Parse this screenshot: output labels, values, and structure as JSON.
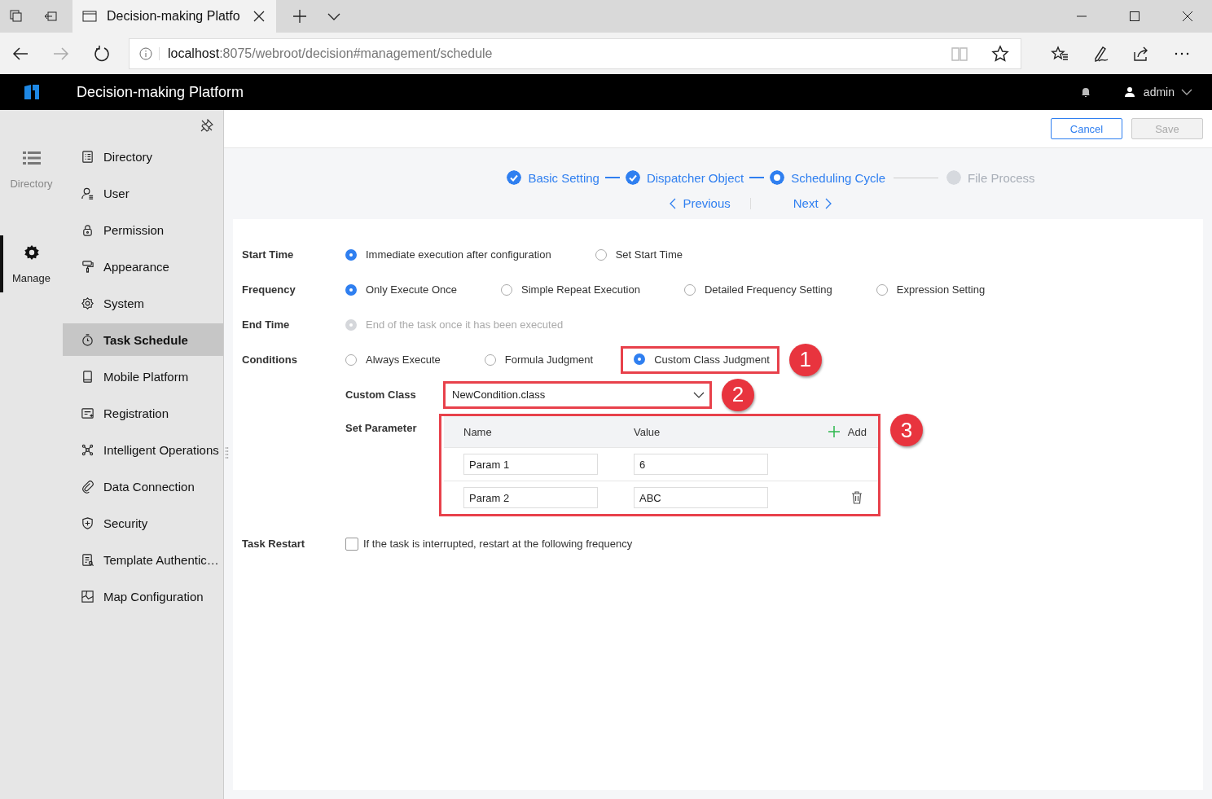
{
  "browser": {
    "tabs": [
      {
        "title": "Decision-making Platfo",
        "selected": true
      }
    ],
    "address": {
      "host": "localhost",
      "path": ":8075/webroot/decision#management/schedule"
    }
  },
  "app": {
    "title": "Decision-making Platform",
    "user": "admin"
  },
  "rail": [
    {
      "label": "Directory",
      "selected": false
    },
    {
      "label": "Manage",
      "selected": true
    }
  ],
  "menu": [
    {
      "label": "Directory",
      "selected": false
    },
    {
      "label": "User",
      "selected": false
    },
    {
      "label": "Permission",
      "selected": false
    },
    {
      "label": "Appearance",
      "selected": false
    },
    {
      "label": "System",
      "selected": false
    },
    {
      "label": "Task Schedule",
      "selected": true
    },
    {
      "label": "Mobile Platform",
      "selected": false
    },
    {
      "label": "Registration",
      "selected": false
    },
    {
      "label": "Intelligent Operations",
      "selected": false
    },
    {
      "label": "Data Connection",
      "selected": false
    },
    {
      "label": "Security",
      "selected": false
    },
    {
      "label": "Template Authentic…",
      "selected": false
    },
    {
      "label": "Map Configuration",
      "selected": false
    }
  ],
  "toolbar": [
    {
      "label": "Cancel",
      "disabled": false
    },
    {
      "label": "Save",
      "disabled": true
    }
  ],
  "steps": [
    {
      "label": "Basic Setting",
      "completed": true,
      "selected": false
    },
    {
      "label": "Dispatcher Object",
      "completed": true,
      "selected": false
    },
    {
      "label": "Scheduling Cycle",
      "completed": false,
      "selected": true
    },
    {
      "label": "File Process",
      "completed": false,
      "selected": false
    }
  ],
  "step_nav": {
    "previous": "Previous",
    "next": "Next"
  },
  "form": [
    {
      "kind": "radio",
      "label": "Start Time",
      "options": [
        {
          "label": "Immediate execution after configuration",
          "selected": true
        },
        {
          "label": "Set Start Time",
          "selected": false
        }
      ]
    },
    {
      "kind": "radio",
      "label": "Frequency",
      "options": [
        {
          "label": "Only Execute Once",
          "selected": true
        },
        {
          "label": "Simple Repeat Execution",
          "selected": false
        },
        {
          "label": "Detailed Frequency Setting",
          "selected": false
        },
        {
          "label": "Expression Setting",
          "selected": false
        }
      ]
    },
    {
      "kind": "radio",
      "label": "End Time",
      "options": [
        {
          "label": "End of the task once it has been executed",
          "selected": true,
          "disabled": true
        }
      ]
    },
    {
      "kind": "radio",
      "label": "Conditions",
      "options": [
        {
          "label": "Always Execute",
          "selected": false
        },
        {
          "label": "Formula Judgment",
          "selected": false
        },
        {
          "label": "Custom Class Judgment",
          "selected": true,
          "callout": "1"
        }
      ]
    },
    {
      "kind": "select",
      "label": "Custom Class",
      "value": "NewCondition.class",
      "callout": "2"
    },
    {
      "kind": "params",
      "label": "Set Parameter",
      "columns": [
        "Name",
        "Value"
      ],
      "add": "Add",
      "callout": "3",
      "rows": [
        {
          "name": "Param 1",
          "value": "6",
          "deletable": false
        },
        {
          "name": "Param 2",
          "value": "ABC",
          "deletable": true
        }
      ]
    },
    {
      "kind": "checkbox",
      "label": "Task Restart",
      "text": "If the task is interrupted, restart at the following frequency",
      "checked": false
    }
  ]
}
